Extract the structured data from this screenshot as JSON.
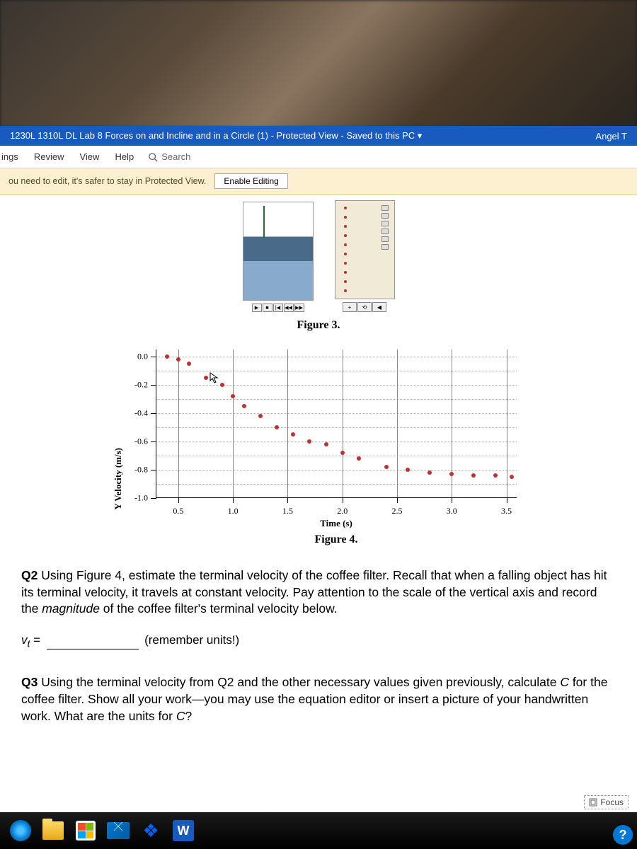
{
  "titlebar": {
    "document_name": "1230L 1310L DL Lab 8 Forces on and Incline and in a Circle (1)",
    "view_mode": "Protected View",
    "save_status": "Saved to this PC",
    "user_name": "Angel T"
  },
  "ribbon": {
    "tabs": [
      "ings",
      "Review",
      "View",
      "Help"
    ],
    "search_placeholder": "Search"
  },
  "protected_view": {
    "message": "ou need to edit, it's safer to stay in Protected View.",
    "button_label": "Enable Editing"
  },
  "figure3": {
    "caption": "Figure 3."
  },
  "chart_data": {
    "type": "scatter",
    "title": "",
    "xlabel": "Time (s)",
    "ylabel": "Y Velocity (m/s)",
    "xlim": [
      0.3,
      3.6
    ],
    "ylim": [
      -1.0,
      0.05
    ],
    "xticks": [
      0.5,
      1.0,
      1.5,
      2.0,
      2.5,
      3.0,
      3.5
    ],
    "yticks": [
      0.0,
      -0.2,
      -0.4,
      -0.6,
      -0.8,
      -1.0
    ],
    "x": [
      0.4,
      0.5,
      0.6,
      0.75,
      0.9,
      1.0,
      1.1,
      1.25,
      1.4,
      1.55,
      1.7,
      1.85,
      2.0,
      2.15,
      2.4,
      2.6,
      2.8,
      3.0,
      3.2,
      3.4,
      3.55
    ],
    "y": [
      0.0,
      -0.02,
      -0.05,
      -0.15,
      -0.2,
      -0.28,
      -0.35,
      -0.42,
      -0.5,
      -0.55,
      -0.6,
      -0.62,
      -0.68,
      -0.72,
      -0.78,
      -0.8,
      -0.82,
      -0.83,
      -0.84,
      -0.84,
      -0.85
    ]
  },
  "figure4": {
    "caption": "Figure 4."
  },
  "questions": {
    "q2_label": "Q2",
    "q2_text_a": " Using Figure 4, estimate the terminal velocity of the coffee filter. Recall that when a falling object has hit its terminal velocity, it travels at constant velocity. Pay attention to the scale of the vertical axis and record the ",
    "q2_italic": "magnitude",
    "q2_text_b": " of the coffee filter's terminal velocity below.",
    "vt_symbol": "v",
    "vt_sub": "t",
    "vt_equals": " = ",
    "vt_hint": "(remember units!)",
    "q3_label": "Q3",
    "q3_text_a": " Using the terminal velocity from Q2 and the other necessary values given previously, calculate ",
    "q3_italic1": "C",
    "q3_text_b": " for the coffee filter. Show all your work—you may use the equation editor or insert a picture of your handwritten work. What are the units for ",
    "q3_italic2": "C",
    "q3_text_c": "?"
  },
  "status": {
    "focus_label": "Focus"
  },
  "help": {
    "symbol": "?"
  },
  "taskbar": {
    "word_letter": "W"
  }
}
